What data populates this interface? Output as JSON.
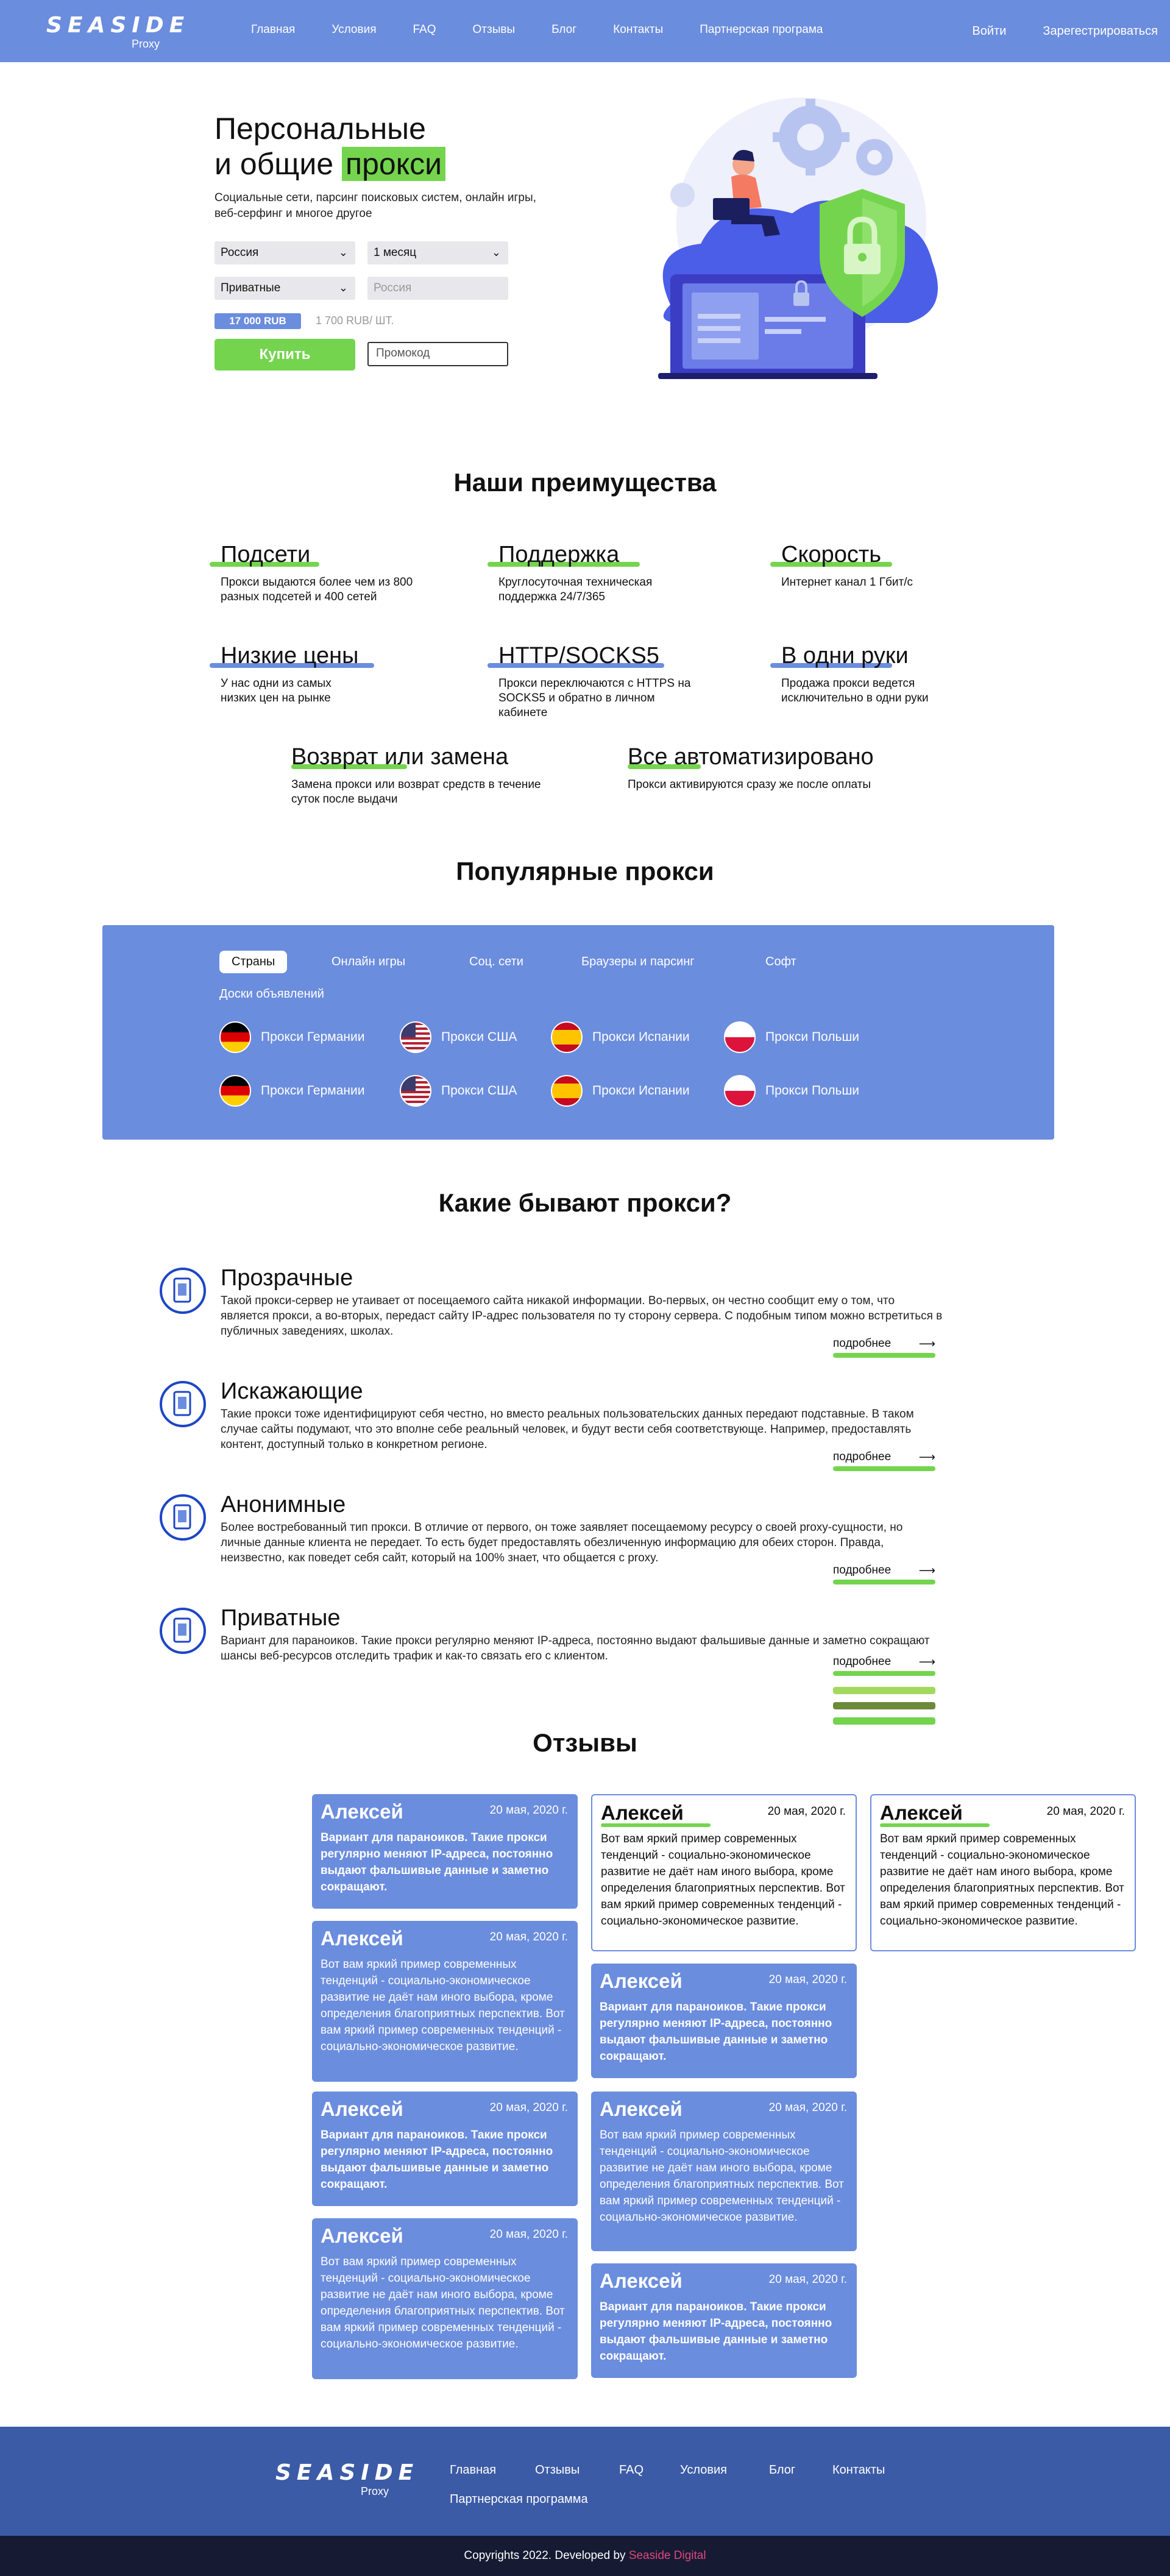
{
  "header": {
    "logo_main": "SEASIDE",
    "logo_sub": "Proxy",
    "nav": [
      "Главная",
      "Условия",
      "FAQ",
      "Отзывы",
      "Блог",
      "Контакты",
      "Партнерская програма"
    ],
    "login": "Войти",
    "register": "Зарегестрироваться"
  },
  "hero": {
    "title_line1": "Персональные",
    "title_line2_a": "и общие ",
    "title_line2_hl": "прокси",
    "subtitle": "Социальные сети, парсинг поисковых систем, онлайн игры, веб-серфинг и многое другое",
    "country_select": "Россия",
    "period_select": "1 месяц",
    "type_select": "Приватные",
    "country_placeholder": "Россия",
    "price": "17 000 RUB",
    "unit_price": "1 700 RUB/ ШТ.",
    "buy_label": "Купить",
    "promo_placeholder": "Промокод"
  },
  "advantages": {
    "title": "Наши преимущества",
    "items": [
      {
        "title": "Подсети",
        "text": "Прокси выдаются более чем из 800 разных подсетей и 400 сетей"
      },
      {
        "title": "Поддержка",
        "text": "Круглосуточная техническая поддержка 24/7/365"
      },
      {
        "title": "Скорость",
        "text": "Интернет канал 1 Гбит/с"
      },
      {
        "title": "Низкие цены",
        "text": "У нас одни из самых низких цен на рынке"
      },
      {
        "title": "HTTP/SOCKS5",
        "text": "Прокси переключаются с HTTPS на SOCKS5 и обратно в личном кабинете"
      },
      {
        "title": "В одни руки",
        "text": "Продажа прокси ведется исключительно в одни руки"
      },
      {
        "title": "Возврат или замена",
        "text": "Замена прокси или возврат средств в течение суток после выдачи"
      },
      {
        "title": "Все автоматизировано",
        "text": "Прокси активируются сразу же после оплаты"
      }
    ],
    "colors": {
      "green": "#74d44e",
      "blue": "#6b8dde"
    }
  },
  "popular": {
    "title": "Популярные прокси",
    "tabs": [
      "Страны",
      "Онлайн игры",
      "Соц. сети",
      "Браузеры и парсинг",
      "Софт",
      "Доски объявлений"
    ],
    "countries": [
      {
        "label": "Прокси Германии",
        "flag": "germany-flag-icon"
      },
      {
        "label": "Прокси США",
        "flag": "usa-flag-icon"
      },
      {
        "label": "Прокси Испании",
        "flag": "spain-flag-icon"
      },
      {
        "label": "Прокси Польши",
        "flag": "poland-flag-icon"
      },
      {
        "label": "Прокси Германии",
        "flag": "germany-flag-icon"
      },
      {
        "label": "Прокси США",
        "flag": "usa-flag-icon"
      },
      {
        "label": "Прокси Испании",
        "flag": "spain-flag-icon"
      },
      {
        "label": "Прокси Польши",
        "flag": "poland-flag-icon"
      }
    ]
  },
  "types": {
    "title": "Какие бывают прокси?",
    "more_label": "подробнее",
    "items": [
      {
        "title": "Прозрачные",
        "text": "Такой прокси-сервер не утаивает от посещаемого сайта никакой информации. Во-первых, он честно сообщит ему о том, что является прокси, а во-вторых, передаст сайту IP-адрес пользователя по ту сторону сервера. С подобным типом можно встретиться в публичных заведениях, школах."
      },
      {
        "title": "Искажающие",
        "text": "Такие прокси тоже идентифицируют себя честно, но вместо реальных пользовательских данных передают подставные. В таком случае сайты подумают, что это вполне себе реальный человек, и будут вести себя соответствующе. Например, предоставлять контент, доступный только в конкретном регионе."
      },
      {
        "title": "Анонимные",
        "text": "Более востребованный тип прокси. В отличие от первого, он тоже заявляет посещаемому ресурсу о своей proxy-сущности, но личные данные клиента не передает. То есть будет предоставлять обезличенную информацию для обеих сторон. Правда, неизвестно, как поведет себя сайт, который на 100% знает, что общается с proxy."
      },
      {
        "title": "Приватные",
        "text": "Вариант для параноиков. Такие прокси регулярно меняют IP-адреса, постоянно выдают фальшивые данные и заметно сокращают шансы веб-ресурсов отследить трафик и как-то связать его с клиентом."
      }
    ]
  },
  "reviews": {
    "title": "Отзывы",
    "short_text": "Вариант для параноиков. Такие прокси регулярно меняют IP-адреса, постоянно выдают фальшивые данные и заметно сокращают.",
    "long_text": "Вот вам яркий пример современных тенденций - социально-экономическое развитие не даёт нам иного выбора, кроме определения благоприятных перспектив. Вот вам яркий пример современных тенденций - социально-экономическое развитие.",
    "author": "Алексей",
    "date": "20 мая, 2020 г."
  },
  "footer": {
    "logo_main": "SEASIDE",
    "logo_sub": "Proxy",
    "nav": [
      "Главная",
      "Отзывы",
      "FAQ",
      "Условия",
      "Блог",
      "Контакты",
      "Партнерская программа"
    ],
    "copyright": "Copyrights 2022. Developed by ",
    "brand": "Seaside Digital"
  }
}
